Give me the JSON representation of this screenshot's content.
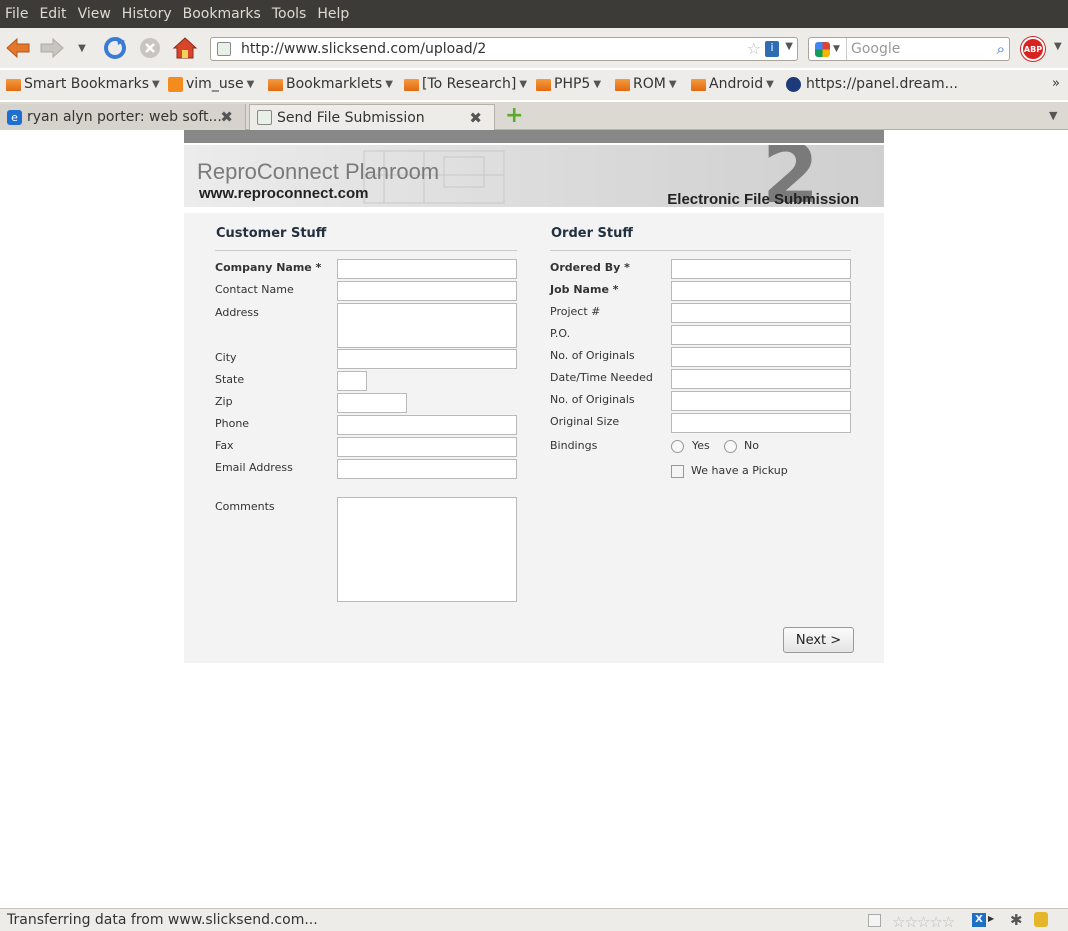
{
  "menu": [
    "File",
    "Edit",
    "View",
    "History",
    "Bookmarks",
    "Tools",
    "Help"
  ],
  "url": "http://www.slicksend.com/upload/2",
  "search_placeholder": "Google",
  "bookmarks": [
    {
      "label": "Smart Bookmarks",
      "icon": "folder-icon",
      "caret": true
    },
    {
      "label": "vim_use",
      "icon": "rss-icon",
      "caret": true
    },
    {
      "label": "Bookmarklets",
      "icon": "folder-icon",
      "caret": true
    },
    {
      "label": "[To Research]",
      "icon": "folder-icon",
      "caret": true
    },
    {
      "label": "PHP5",
      "icon": "folder-icon",
      "caret": true
    },
    {
      "label": "ROM",
      "icon": "folder-icon",
      "caret": true
    },
    {
      "label": "Android",
      "icon": "folder-icon",
      "caret": true
    },
    {
      "label": "https://panel.dream...",
      "icon": "moon-icon",
      "caret": false
    }
  ],
  "tabs": [
    {
      "label": "ryan alyn porter: web soft...",
      "active": false
    },
    {
      "label": "Send File Submission",
      "active": true
    }
  ],
  "banner": {
    "title": "ReproConnect Planroom",
    "site": "www.reproconnect.com",
    "subtitle": "Electronic File Submission",
    "big_number": "2"
  },
  "customer": {
    "title": "Customer Stuff",
    "labels": {
      "company": "Company Name *",
      "contact": "Contact Name",
      "address": "Address",
      "city": "City",
      "state": "State",
      "zip": "Zip",
      "phone": "Phone",
      "fax": "Fax",
      "email": "Email Address",
      "comments": "Comments"
    }
  },
  "order": {
    "title": "Order Stuff",
    "labels": {
      "ordered_by": "Ordered By *",
      "job_name": "Job Name *",
      "project": "Project #",
      "po": "P.O.",
      "originals1": "No. of Originals",
      "date_needed": "Date/Time Needed",
      "originals2": "No. of Originals",
      "original_size": "Original Size",
      "bindings": "Bindings",
      "yes": "Yes",
      "no": "No",
      "pickup": "We have a Pickup"
    }
  },
  "next_label": "Next >",
  "status": "Transferring data from www.slicksend.com..."
}
